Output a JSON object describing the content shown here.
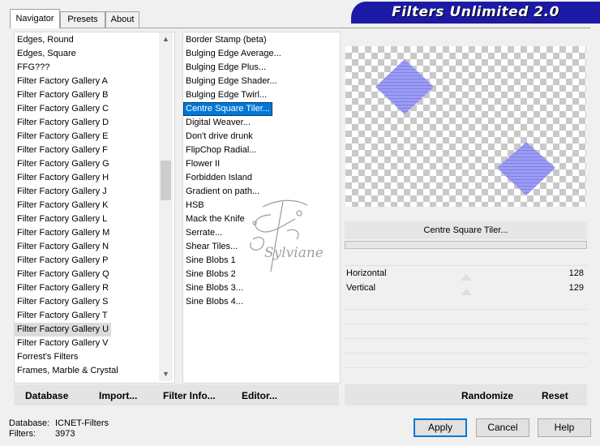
{
  "tabs": [
    {
      "label": "Navigator",
      "active": true
    },
    {
      "label": "Presets",
      "active": false
    },
    {
      "label": "About",
      "active": false
    }
  ],
  "banner": {
    "title": "Filters Unlimited 2.0",
    "color": "#1b1aa6"
  },
  "categories": [
    "Edges, Round",
    "Edges, Square",
    "FFG???",
    "Filter Factory Gallery A",
    "Filter Factory Gallery B",
    "Filter Factory Gallery C",
    "Filter Factory Gallery D",
    "Filter Factory Gallery E",
    "Filter Factory Gallery F",
    "Filter Factory Gallery G",
    "Filter Factory Gallery H",
    "Filter Factory Gallery J",
    "Filter Factory Gallery K",
    "Filter Factory Gallery L",
    "Filter Factory Gallery M",
    "Filter Factory Gallery N",
    "Filter Factory Gallery P",
    "Filter Factory Gallery Q",
    "Filter Factory Gallery R",
    "Filter Factory Gallery S",
    "Filter Factory Gallery T",
    "Filter Factory Gallery U",
    "Filter Factory Gallery V",
    "Forrest's Filters",
    "Frames, Marble & Crystal"
  ],
  "selected_category": "Filter Factory Gallery U",
  "filters": [
    "Border Stamp (beta)",
    "Bulging Edge Average...",
    "Bulging Edge Plus...",
    "Bulging Edge Shader...",
    "Bulging Edge Twirl...",
    "Centre Square Tiler...",
    "Digital Weaver...",
    "Don't drive drunk",
    "FlipChop Radial...",
    "Flower II",
    "Forbidden Island",
    "Gradient on path...",
    "HSB",
    "Mack the Knife",
    "Serrate...",
    "Shear Tiles...",
    "Sine Blobs 1",
    "Sine Blobs 2",
    "Sine Blobs 3...",
    "Sine Blobs 4..."
  ],
  "selected_filter": "Centre Square Tiler...",
  "watermark": "Sylviane",
  "preview": {
    "filter_name": "Centre Square Tiler...",
    "shape_color": "#8d8ef0"
  },
  "params": [
    {
      "label": "Horizontal",
      "value": "128",
      "level": 0.5
    },
    {
      "label": "Vertical",
      "value": "129",
      "level": 0.5
    }
  ],
  "toolbar": {
    "database": "Database",
    "import": "Import...",
    "filter_info": "Filter Info...",
    "editor": "Editor...",
    "randomize": "Randomize",
    "reset": "Reset"
  },
  "status": {
    "database_label": "Database:",
    "database_value": "ICNET-Filters",
    "filters_label": "Filters:",
    "filters_value": "3973"
  },
  "buttons": {
    "apply": "Apply",
    "cancel": "Cancel",
    "help": "Help"
  },
  "colors": {
    "selection": "#0078d7",
    "accent": "#1b1aa6"
  }
}
